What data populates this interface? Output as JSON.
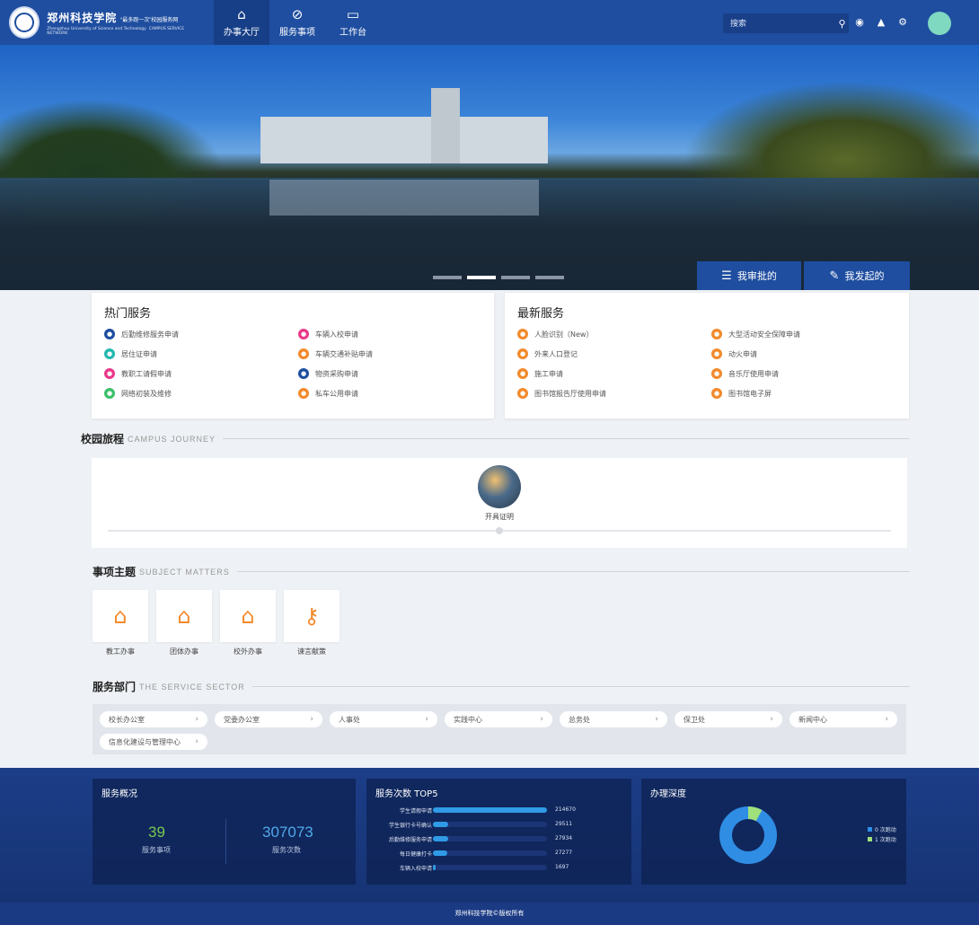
{
  "brand": {
    "name_cn": "郑州科技学院",
    "slogan": "“最多跑一次”校园服务网",
    "name_en": "Zhengzhou University of Science and Technology",
    "network_en": "CAMPUS SERVICE NETWORK"
  },
  "nav": {
    "tabs": [
      {
        "label": "办事大厅",
        "icon": "home-icon",
        "active": true
      },
      {
        "label": "服务事项",
        "icon": "compass-icon",
        "active": false
      },
      {
        "label": "工作台",
        "icon": "monitor-icon",
        "active": false
      }
    ]
  },
  "search": {
    "placeholder": "搜索"
  },
  "banner": {
    "tabs": [
      {
        "label": "我审批的",
        "icon": "approve-list-icon"
      },
      {
        "label": "我发起的",
        "icon": "edit-doc-icon"
      }
    ],
    "active_slide": 2,
    "slides": 4
  },
  "hot_services": {
    "title": "热门服务",
    "items": [
      {
        "label": "后勤维修服务申请",
        "color": "#1f4ea0"
      },
      {
        "label": "车辆入校申请",
        "color": "#e8398a"
      },
      {
        "label": "居住证申请",
        "color": "#22b8b0"
      },
      {
        "label": "车辆交通补贴申请",
        "color": "#f28a2c"
      },
      {
        "label": "教职工请假申请",
        "color": "#e8398a"
      },
      {
        "label": "物资采购申请",
        "color": "#1f4ea0"
      },
      {
        "label": "网络初装及维修",
        "color": "#3cc06a"
      },
      {
        "label": "私车公用申请",
        "color": "#f28a2c"
      }
    ]
  },
  "new_services": {
    "title": "最新服务",
    "items": [
      {
        "label": "人脸识别（New）",
        "color": "#f28a2c"
      },
      {
        "label": "大型活动安全保障申请",
        "color": "#f28a2c"
      },
      {
        "label": "外来人口登记",
        "color": "#f28a2c"
      },
      {
        "label": "动火申请",
        "color": "#f28a2c"
      },
      {
        "label": "施工申请",
        "color": "#f28a2c"
      },
      {
        "label": "音乐厅使用申请",
        "color": "#f28a2c"
      },
      {
        "label": "图书馆报告厅使用申请",
        "color": "#f28a2c"
      },
      {
        "label": "图书馆电子屏",
        "color": "#f28a2c"
      }
    ]
  },
  "journey": {
    "title": "校园旅程",
    "title_en": "CAMPUS JOURNEY",
    "item": "开具证明"
  },
  "subjects": {
    "title": "事项主题",
    "title_en": "SUBJECT MATTERS",
    "items": [
      {
        "label": "教工办事",
        "icon": "house-icon"
      },
      {
        "label": "团体办事",
        "icon": "house-icon"
      },
      {
        "label": "校外办事",
        "icon": "house-icon"
      },
      {
        "label": "谏言献策",
        "icon": "key-icon"
      }
    ]
  },
  "sectors": {
    "title": "服务部门",
    "title_en": "THE SERVICE SECTOR",
    "items": [
      "校长办公室",
      "党委办公室",
      "人事处",
      "实践中心",
      "总务处",
      "保卫处",
      "新闻中心",
      "信息化建设与管理中心"
    ]
  },
  "overview": {
    "title": "服务概况",
    "items_count": "39",
    "items_label": "服务事项",
    "times_count": "307073",
    "times_label": "服务次数"
  },
  "top5": {
    "title": "服务次数 TOP5",
    "rows": [
      {
        "label": "学生请假申请",
        "value": 214670
      },
      {
        "label": "学生银行卡号确认",
        "value": 29511
      },
      {
        "label": "后勤维修服务申请",
        "value": 27934
      },
      {
        "label": "每日健康打卡",
        "value": 27277
      },
      {
        "label": "车辆入校申请",
        "value": 1697
      }
    ]
  },
  "depth": {
    "title": "办理深度",
    "legend": [
      {
        "label": "0 次跑动",
        "color": "#2f8de4",
        "share": 0.92
      },
      {
        "label": "1 次跑动",
        "color": "#9fe07a",
        "share": 0.08
      }
    ]
  },
  "footer": {
    "text": "郑州科技学院©版权所有"
  }
}
